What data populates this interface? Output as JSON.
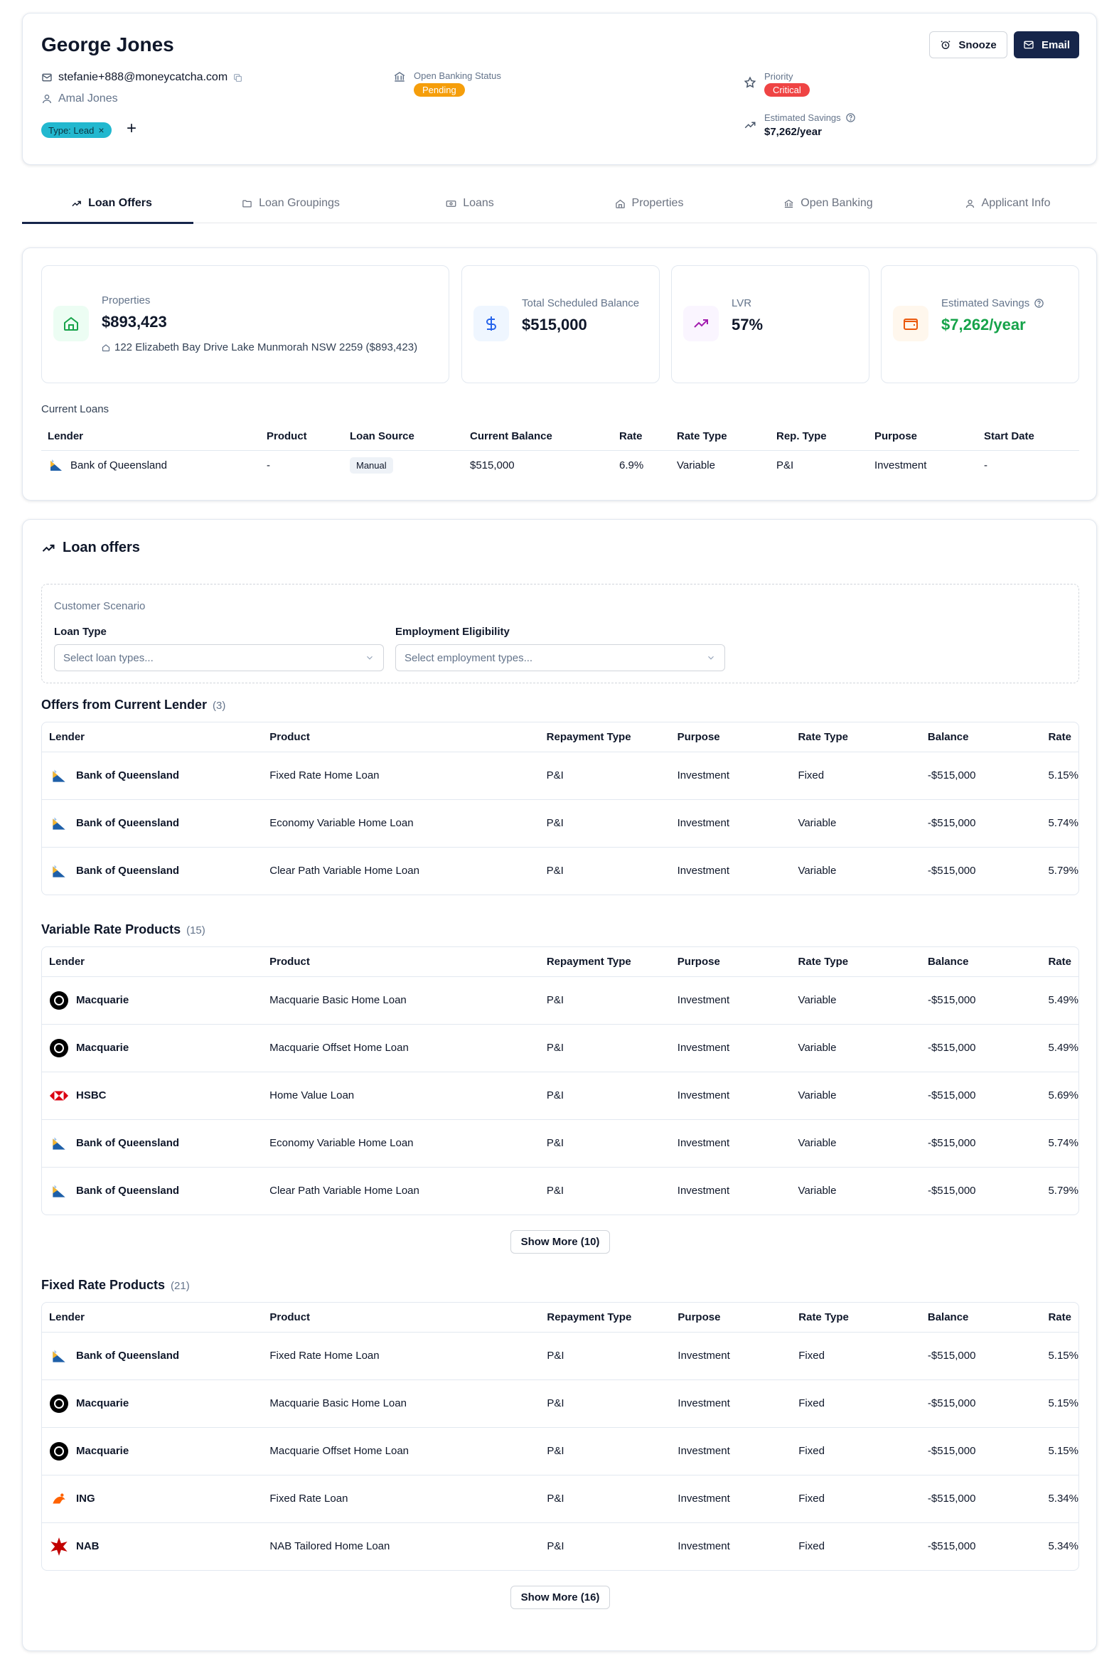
{
  "header": {
    "name": "George Jones",
    "email": "stefanie+888@moneycatcha.com",
    "co_applicant": "Amal Jones",
    "type_chip": "Type: Lead",
    "add_label": "+",
    "open_banking_label": "Open Banking Status",
    "open_banking_status": "Pending",
    "priority_label": "Priority",
    "priority_value": "Critical",
    "savings_label": "Estimated Savings",
    "savings_value": "$7,262/year",
    "snooze_label": "Snooze",
    "email_label": "Email",
    "colors": {
      "pending": "#f59e0b",
      "critical": "#ef4444",
      "chip": "#22b8cf",
      "primary": "#16254a"
    }
  },
  "tabs": [
    {
      "label": "Loan Offers",
      "icon": "trending-up-icon",
      "active": true
    },
    {
      "label": "Loan Groupings",
      "icon": "folder-icon",
      "active": false
    },
    {
      "label": "Loans",
      "icon": "banknote-icon",
      "active": false
    },
    {
      "label": "Properties",
      "icon": "home-icon",
      "active": false
    },
    {
      "label": "Open Banking",
      "icon": "bank-icon",
      "active": false
    },
    {
      "label": "Applicant Info",
      "icon": "user-icon",
      "active": false
    }
  ],
  "summary": {
    "properties_label": "Properties",
    "properties_value": "$893,423",
    "properties_address": "122 Elizabeth Bay Drive Lake Munmorah NSW 2259 ($893,423)",
    "balance_label": "Total Scheduled Balance",
    "balance_value": "$515,000",
    "lvr_label": "LVR",
    "lvr_value": "57%",
    "savings_label": "Estimated Savings",
    "savings_value": "$7,262/year"
  },
  "current_loans": {
    "title": "Current Loans",
    "columns": [
      "Lender",
      "Product",
      "Loan Source",
      "Current Balance",
      "Rate",
      "Rate Type",
      "Rep. Type",
      "Purpose",
      "Start Date"
    ],
    "rows": [
      {
        "lender": "Bank of Queensland",
        "product": "-",
        "source": "Manual",
        "balance": "$515,000",
        "rate": "6.9%",
        "rate_type": "Variable",
        "rep_type": "P&I",
        "purpose": "Investment",
        "start_date": "-"
      }
    ]
  },
  "offers": {
    "title": "Loan offers",
    "scenario": {
      "caption": "Customer Scenario",
      "loan_type_label": "Loan Type",
      "loan_type_placeholder": "Select loan types...",
      "employment_label": "Employment Eligibility",
      "employment_placeholder": "Select employment types..."
    },
    "columns": [
      "Lender",
      "Product",
      "Repayment Type",
      "Purpose",
      "Rate Type",
      "Balance",
      "Rate"
    ],
    "sections": [
      {
        "title": "Offers from Current Lender",
        "count": "(3)",
        "rows": [
          {
            "lender": "Bank of Queensland",
            "logo": "boq",
            "product": "Fixed Rate Home Loan",
            "repayment": "P&I",
            "purpose": "Investment",
            "rate_type": "Fixed",
            "balance": "-$515,000",
            "rate": "5.15%"
          },
          {
            "lender": "Bank of Queensland",
            "logo": "boq",
            "product": "Economy Variable Home Loan",
            "repayment": "P&I",
            "purpose": "Investment",
            "rate_type": "Variable",
            "balance": "-$515,000",
            "rate": "5.74%"
          },
          {
            "lender": "Bank of Queensland",
            "logo": "boq",
            "product": "Clear Path Variable Home Loan",
            "repayment": "P&I",
            "purpose": "Investment",
            "rate_type": "Variable",
            "balance": "-$515,000",
            "rate": "5.79%"
          }
        ]
      },
      {
        "title": "Variable Rate Products",
        "count": "(15)",
        "show_more": "Show More (10)",
        "rows": [
          {
            "lender": "Macquarie",
            "logo": "macquarie",
            "product": "Macquarie Basic Home Loan",
            "repayment": "P&I",
            "purpose": "Investment",
            "rate_type": "Variable",
            "balance": "-$515,000",
            "rate": "5.49%"
          },
          {
            "lender": "Macquarie",
            "logo": "macquarie",
            "product": "Macquarie Offset Home Loan",
            "repayment": "P&I",
            "purpose": "Investment",
            "rate_type": "Variable",
            "balance": "-$515,000",
            "rate": "5.49%"
          },
          {
            "lender": "HSBC",
            "logo": "hsbc",
            "product": "Home Value Loan",
            "repayment": "P&I",
            "purpose": "Investment",
            "rate_type": "Variable",
            "balance": "-$515,000",
            "rate": "5.69%"
          },
          {
            "lender": "Bank of Queensland",
            "logo": "boq",
            "product": "Economy Variable Home Loan",
            "repayment": "P&I",
            "purpose": "Investment",
            "rate_type": "Variable",
            "balance": "-$515,000",
            "rate": "5.74%"
          },
          {
            "lender": "Bank of Queensland",
            "logo": "boq",
            "product": "Clear Path Variable Home Loan",
            "repayment": "P&I",
            "purpose": "Investment",
            "rate_type": "Variable",
            "balance": "-$515,000",
            "rate": "5.79%"
          }
        ]
      },
      {
        "title": "Fixed Rate Products",
        "count": "(21)",
        "show_more": "Show More (16)",
        "rows": [
          {
            "lender": "Bank of Queensland",
            "logo": "boq",
            "product": "Fixed Rate Home Loan",
            "repayment": "P&I",
            "purpose": "Investment",
            "rate_type": "Fixed",
            "balance": "-$515,000",
            "rate": "5.15%"
          },
          {
            "lender": "Macquarie",
            "logo": "macquarie",
            "product": "Macquarie Basic Home Loan",
            "repayment": "P&I",
            "purpose": "Investment",
            "rate_type": "Fixed",
            "balance": "-$515,000",
            "rate": "5.15%"
          },
          {
            "lender": "Macquarie",
            "logo": "macquarie",
            "product": "Macquarie Offset Home Loan",
            "repayment": "P&I",
            "purpose": "Investment",
            "rate_type": "Fixed",
            "balance": "-$515,000",
            "rate": "5.15%"
          },
          {
            "lender": "ING",
            "logo": "ing",
            "product": "Fixed Rate Loan",
            "repayment": "P&I",
            "purpose": "Investment",
            "rate_type": "Fixed",
            "balance": "-$515,000",
            "rate": "5.34%"
          },
          {
            "lender": "NAB",
            "logo": "nab",
            "product": "NAB Tailored Home Loan",
            "repayment": "P&I",
            "purpose": "Investment",
            "rate_type": "Fixed",
            "balance": "-$515,000",
            "rate": "5.34%"
          }
        ]
      }
    ]
  }
}
